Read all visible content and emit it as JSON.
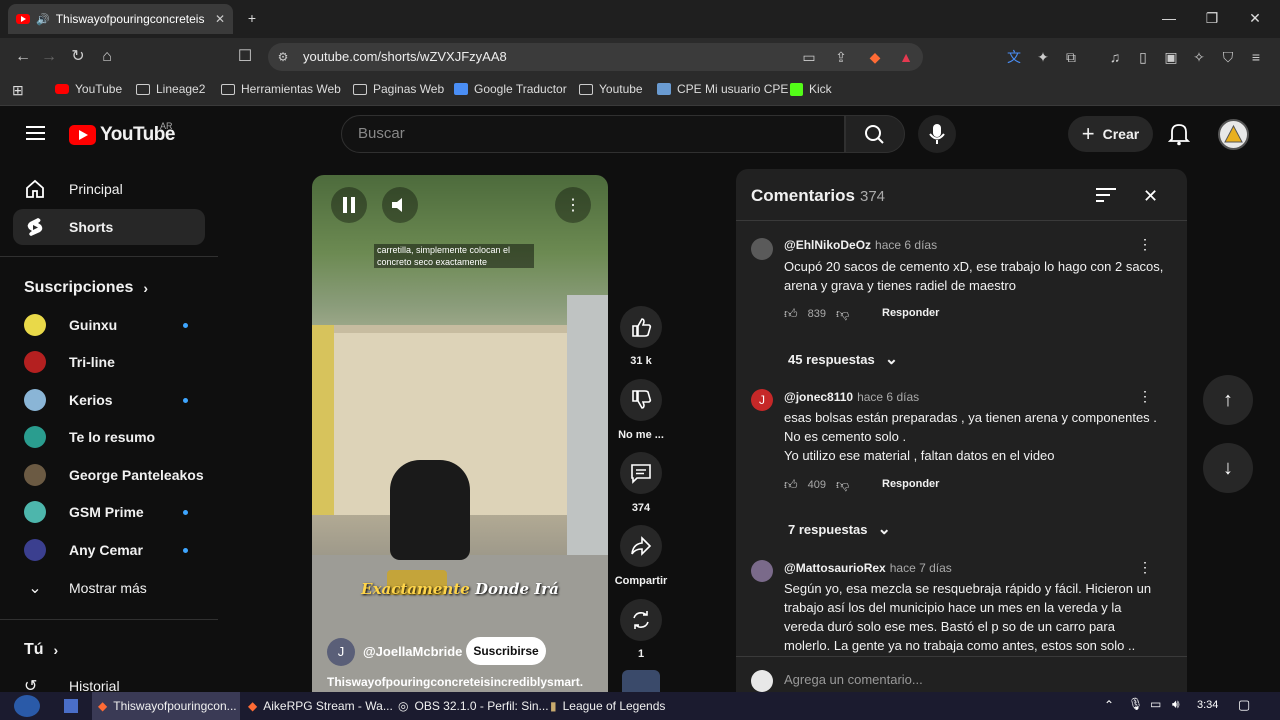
{
  "browser": {
    "tab_title": "Thiswayofpouringconcreteis",
    "url": "youtube.com/shorts/wZVXJFzyAA8",
    "bookmarks": [
      "YouTube",
      "Lineage2",
      "Herramientas Web",
      "Paginas Web",
      "Google Traductor",
      "Youtube",
      "CPE Mi usuario CPE",
      "Kick"
    ]
  },
  "youtube": {
    "logo_text": "YouTube",
    "country": "AR",
    "search_placeholder": "Buscar",
    "create_label": "Crear"
  },
  "sidebar": {
    "main": [
      {
        "label": "Principal",
        "icon": "home-icon"
      },
      {
        "label": "Shorts",
        "icon": "shorts-icon"
      }
    ],
    "subscriptions_title": "Suscripciones",
    "subscriptions": [
      {
        "name": "Guinxu",
        "new": true,
        "color": "#e9d949"
      },
      {
        "name": "Tri-line",
        "new": false,
        "color": "#b42020"
      },
      {
        "name": "Kerios",
        "new": true,
        "color": "#8ab5d6"
      },
      {
        "name": "Te lo resumo",
        "new": false,
        "color": "#2a9d8f"
      },
      {
        "name": "George Panteleakos",
        "new": false,
        "color": "#6b5a43"
      },
      {
        "name": "GSM Prime",
        "new": true,
        "color": "#4db6ac"
      },
      {
        "name": "Any Cemar",
        "new": true,
        "color": "#3b3f8f"
      }
    ],
    "show_more": "Mostrar más",
    "you_title": "Tú",
    "history": "Historial"
  },
  "video": {
    "caption_top": "carretilla, simplemente colocan el concreto seco exactamente",
    "caption_bottom_hl": "Exactamente",
    "caption_bottom_rest": "Donde Irá",
    "channel_initial": "J",
    "channel": "@JoellaMcbride",
    "subscribe": "Suscribirse",
    "title": "Thiswayofpouringconcreteisincrediblysmart."
  },
  "actions": {
    "likes": "31 k",
    "dislike": "No me ...",
    "comments": "374",
    "share": "Compartir",
    "remix": "1"
  },
  "comments": {
    "title": "Comentarios",
    "count": "374",
    "items": [
      {
        "user": "@EhlNikoDeOz",
        "time": "hace 6 días",
        "text": "Ocupó 20 sacos de cemento xD, ese trabajo lo hago con 2 sacos, arena y grava y tienes radiel de maestro",
        "likes": "839",
        "reply": "Responder",
        "replies": "45 respuestas",
        "avatar_color": "#5a5a5a",
        "avatar_letter": ""
      },
      {
        "user": "@jonec8110",
        "time": "hace 6 días",
        "text": "esas bolsas están preparadas , ya tienen arena y componentes . No es cemento solo .\nYo utilizo ese material , faltan datos en el video",
        "likes": "409",
        "reply": "Responder",
        "replies": "7 respuestas",
        "avatar_color": "#c62828",
        "avatar_letter": "J"
      },
      {
        "user": "@MattosaurioRex",
        "time": "hace 7 días",
        "text": "Según yo, esa mezcla se resquebraja rápido y fácil. Hicieron un trabajo así los del municipio hace un mes en la vereda y la vereda duró solo ese mes. Bastó el p so de un carro para molerlo. La gente ya no trabaja como antes, estos son solo ..",
        "likes": "",
        "reply": "",
        "replies": "",
        "avatar_color": "#7a6a8a",
        "avatar_letter": ""
      }
    ],
    "input_placeholder": "Agrega un comentario..."
  },
  "taskbar": {
    "items": [
      "Thiswayofpouringcon...",
      "AikeRPG Stream - Wa...",
      "OBS 32.1.0 - Perfil: Sin...",
      "League of Legends"
    ],
    "time": "3:34"
  }
}
